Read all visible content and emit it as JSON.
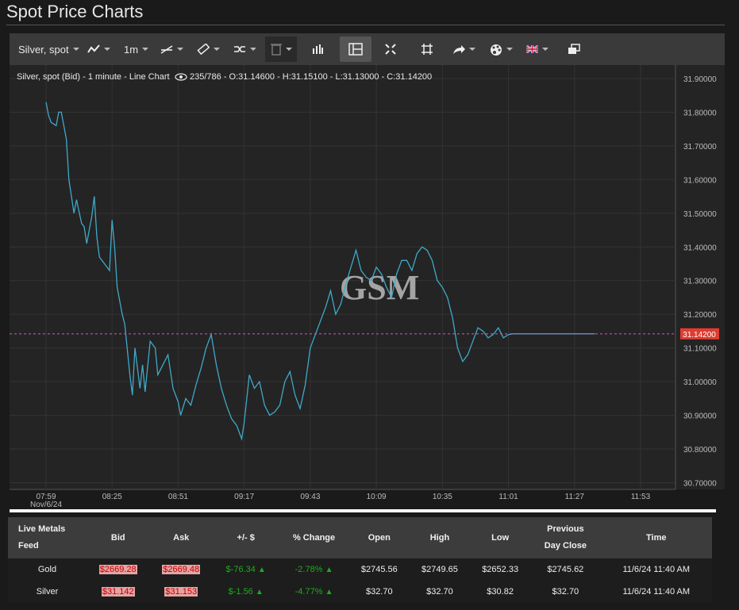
{
  "page": {
    "title": "Spot Price Charts"
  },
  "toolbar": {
    "symbol": "Silver, spot",
    "interval": "1m",
    "icons": [
      "line-chart-icon",
      "crosshair-icon",
      "ruler-icon",
      "compare-icon",
      "trash-icon",
      "volume-icon",
      "layout-icon",
      "fullscreen-icon",
      "fit-icon",
      "share-icon",
      "palette-icon",
      "flag-uk-icon",
      "window-icon"
    ]
  },
  "chart_header": {
    "label": "Silver, spot (Bid) - 1 minute - Line Chart",
    "stats": "235/786 - O:31.14600 - H:31.15100 - L:31.13000 - C:31.14200"
  },
  "watermark": "GSM",
  "colors": {
    "line": "#3fa9c9",
    "price_tag": "#e03c31",
    "price_line": "#c060c0",
    "grid": "#333333",
    "background": "#242424"
  },
  "chart_data": {
    "type": "line",
    "title": "Silver, spot (Bid) - 1 minute - Line Chart",
    "xlabel": "",
    "ylabel": "",
    "x_ticks": [
      "07:59",
      "08:25",
      "08:51",
      "09:17",
      "09:43",
      "10:09",
      "10:35",
      "11:01",
      "11:27",
      "11:53"
    ],
    "x_date_label": "Nov/6/24",
    "y_ticks": [
      "31.90000",
      "31.80000",
      "31.70000",
      "31.60000",
      "31.50000",
      "31.40000",
      "31.30000",
      "31.20000",
      "31.10000",
      "31.00000",
      "30.90000",
      "30.80000",
      "30.70000"
    ],
    "ylim": [
      30.68,
      31.94
    ],
    "current_price": 31.142,
    "current_price_label": "31.14200",
    "series": [
      {
        "x": [
          "07:59",
          "08:00",
          "08:01",
          "08:03",
          "08:04",
          "08:05",
          "08:07",
          "08:08",
          "08:10",
          "08:11",
          "08:13",
          "08:14",
          "08:15",
          "08:17",
          "08:18",
          "08:19",
          "08:20",
          "08:22",
          "08:24",
          "08:25",
          "08:26",
          "08:27",
          "08:29",
          "08:30",
          "08:32",
          "08:33",
          "08:34",
          "08:36",
          "08:37",
          "08:38",
          "08:40",
          "08:42",
          "08:43",
          "08:45",
          "08:47",
          "08:49",
          "08:51",
          "08:52",
          "08:54",
          "08:56",
          "08:58",
          "09:00",
          "09:02",
          "09:04",
          "09:06",
          "09:08",
          "09:10",
          "09:12",
          "09:14",
          "09:16",
          "09:17",
          "09:19",
          "09:21",
          "09:23",
          "09:25",
          "09:27",
          "09:29",
          "09:31",
          "09:33",
          "09:35",
          "09:37",
          "09:39",
          "09:41",
          "09:43",
          "09:45",
          "09:47",
          "09:49",
          "09:51",
          "09:53",
          "09:55",
          "09:57",
          "09:59",
          "10:01",
          "10:03",
          "10:05",
          "10:07",
          "10:09",
          "10:11",
          "10:13",
          "10:15",
          "10:17",
          "10:19",
          "10:21",
          "10:23",
          "10:25",
          "10:27",
          "10:29",
          "10:31",
          "10:33",
          "10:35",
          "10:37",
          "10:39",
          "10:41",
          "10:43",
          "10:45",
          "10:47",
          "10:49",
          "10:51",
          "10:53",
          "10:55",
          "10:57",
          "10:59",
          "11:01",
          "11:03",
          "11:05",
          "11:07",
          "11:09",
          "11:11",
          "11:13",
          "11:15",
          "11:17",
          "11:19",
          "11:21",
          "11:23",
          "11:25",
          "11:27",
          "11:29",
          "11:31",
          "11:33",
          "11:35"
        ],
        "y": [
          31.83,
          31.79,
          31.77,
          31.76,
          31.8,
          31.8,
          31.72,
          31.6,
          31.5,
          31.54,
          31.47,
          31.46,
          31.41,
          31.49,
          31.55,
          31.43,
          31.37,
          31.35,
          31.33,
          31.48,
          31.4,
          31.28,
          31.2,
          31.17,
          31.02,
          30.96,
          31.1,
          30.98,
          31.05,
          30.97,
          31.12,
          31.1,
          31.02,
          31.05,
          31.08,
          30.98,
          30.94,
          30.9,
          30.95,
          30.93,
          30.99,
          31.04,
          31.1,
          31.14,
          31.05,
          30.98,
          30.93,
          30.89,
          30.87,
          30.83,
          30.88,
          31.02,
          30.98,
          31.0,
          30.93,
          30.9,
          30.91,
          30.93,
          31.0,
          31.03,
          30.96,
          30.92,
          30.99,
          31.1,
          31.14,
          31.18,
          31.22,
          31.27,
          31.2,
          31.23,
          31.29,
          31.34,
          31.39,
          31.33,
          31.31,
          31.3,
          31.34,
          31.32,
          31.28,
          31.25,
          31.32,
          31.36,
          31.36,
          31.33,
          31.38,
          31.4,
          31.39,
          31.36,
          31.3,
          31.28,
          31.25,
          31.19,
          31.1,
          31.06,
          31.08,
          31.12,
          31.16,
          31.15,
          31.13,
          31.14,
          31.16,
          31.13,
          31.14,
          31.142,
          31.142,
          31.142,
          31.142,
          31.142,
          31.142,
          31.142,
          31.142,
          31.142,
          31.142,
          31.142,
          31.142,
          31.142,
          31.142,
          31.142,
          31.142,
          31.142
        ]
      }
    ]
  },
  "table": {
    "headers": [
      "Live Metals Feed",
      "Bid",
      "Ask",
      "+/- $",
      "% Change",
      "Open",
      "High",
      "Low",
      "Previous Day Close",
      "Time"
    ],
    "header_lines": [
      [
        "Live Metals",
        "Feed"
      ],
      [
        "Bid"
      ],
      [
        "Ask"
      ],
      [
        "+/- $"
      ],
      [
        "% Change"
      ],
      [
        "Open"
      ],
      [
        "High"
      ],
      [
        "Low"
      ],
      [
        "Previous",
        "Day Close"
      ],
      [
        "Time"
      ]
    ],
    "rows": [
      {
        "metal": "Gold",
        "bid": "$2669.28",
        "ask": "$2669.48",
        "change": "$-76.34",
        "pct": "-2.78%",
        "open": "$2745.56",
        "high": "$2749.65",
        "low": "$2652.33",
        "prev": "$2745.62",
        "time": "11/6/24 11:40 AM"
      },
      {
        "metal": "Silver",
        "bid": "$31.142",
        "ask": "$31.153",
        "change": "$-1.56",
        "pct": "-4.77%",
        "open": "$32.70",
        "high": "$32.70",
        "low": "$30.82",
        "prev": "$32.70",
        "time": "11/6/24 11:40 AM"
      }
    ]
  }
}
